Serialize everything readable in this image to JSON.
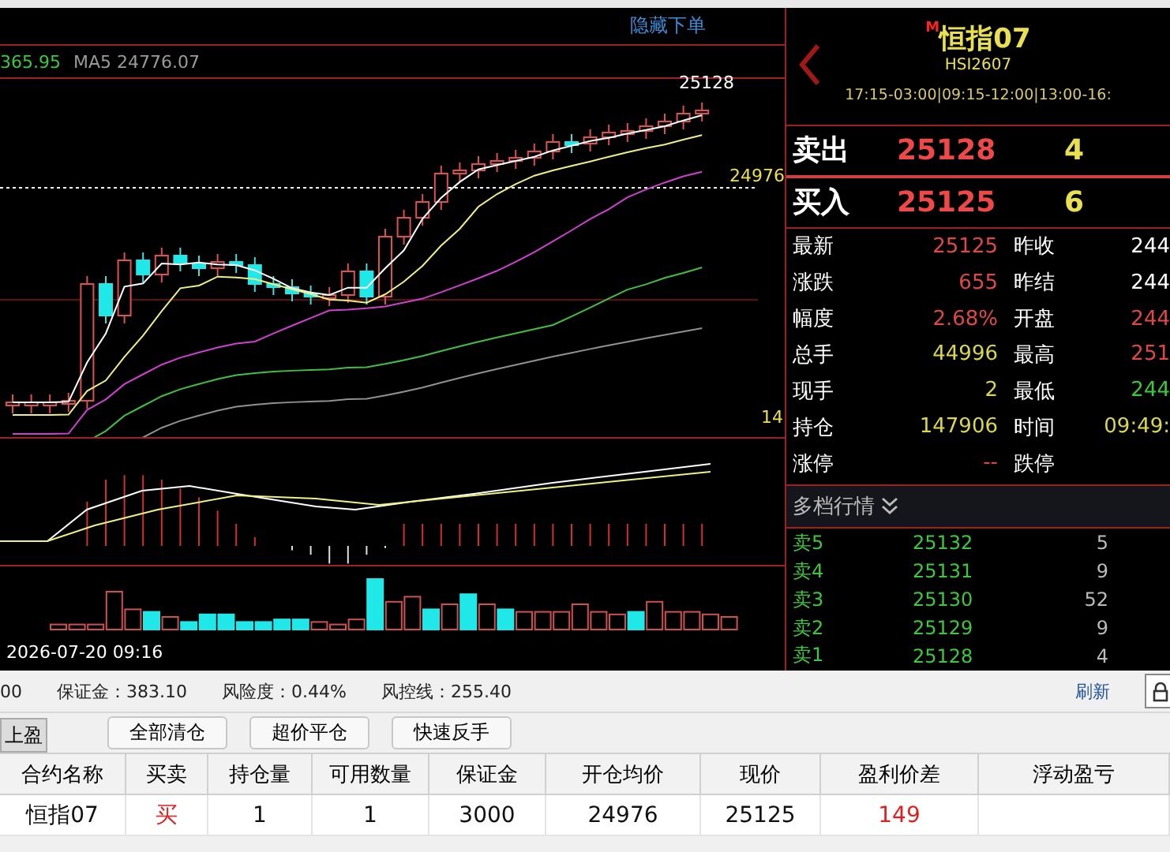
{
  "chart": {
    "hide_order_link": "隐藏下单",
    "ma_legend": [
      {
        "text": "365.95",
        "color": "#3cc83c"
      },
      {
        "text": "MA5 24776.07",
        "color": "#9a9a9a"
      }
    ],
    "last_price_label": "25128",
    "order_price_label": "24976",
    "axis_label": "14",
    "date_label": "2026-07-20 09:16"
  },
  "quote": {
    "market_badge": "M",
    "title": "恒指07",
    "code": "HSI2607",
    "sessions": "17:15-03:00|09:15-12:00|13:00-16:",
    "ask": {
      "label": "卖出",
      "price": "25128",
      "volume": "4"
    },
    "bid": {
      "label": "买入",
      "price": "25125",
      "volume": "6"
    },
    "stats": [
      {
        "left": {
          "label": "最新",
          "value": "25125",
          "color": "#e04848"
        },
        "right": {
          "label": "昨收",
          "value": "244",
          "color": "#ffffff"
        }
      },
      {
        "left": {
          "label": "涨跌",
          "value": "655",
          "color": "#e04848"
        },
        "right": {
          "label": "昨结",
          "value": "244",
          "color": "#ffffff"
        }
      },
      {
        "left": {
          "label": "幅度",
          "value": "2.68%",
          "color": "#e04848"
        },
        "right": {
          "label": "开盘",
          "value": "244",
          "color": "#e04848"
        }
      },
      {
        "left": {
          "label": "总手",
          "value": "44996",
          "color": "#d8d84a"
        },
        "right": {
          "label": "最高",
          "value": "251",
          "color": "#e04848"
        }
      },
      {
        "left": {
          "label": "现手",
          "value": "2",
          "color": "#d8d84a"
        },
        "right": {
          "label": "最低",
          "value": "244",
          "color": "#3cc83c"
        }
      },
      {
        "left": {
          "label": "持仓",
          "value": "147906",
          "color": "#d8d84a"
        },
        "right": {
          "label": "时间",
          "value": "09:49:",
          "color": "#d8d84a"
        }
      },
      {
        "left": {
          "label": "涨停",
          "value": "--",
          "color": "#e04848"
        },
        "right": {
          "label": "跌停"
        }
      }
    ],
    "depth_title": "多档行情",
    "depth": [
      {
        "label": "卖5",
        "price": "25132",
        "volume": "5"
      },
      {
        "label": "卖4",
        "price": "25131",
        "volume": "9"
      },
      {
        "label": "卖3",
        "price": "25130",
        "volume": "52"
      },
      {
        "label": "卖2",
        "price": "25129",
        "volume": "9"
      },
      {
        "label": "卖1",
        "price": "25128",
        "volume": "4"
      }
    ]
  },
  "account": {
    "items": [
      "00",
      "保证金：383.10",
      "风险度：0.44%",
      "风控线：255.40"
    ],
    "refresh": "刷新"
  },
  "tabs": [
    {
      "label": "上盈",
      "selected": true
    }
  ],
  "buttons": [
    "全部清仓",
    "超价平仓",
    "快速反手"
  ],
  "table": {
    "columns": [
      "合约名称",
      "买卖",
      "持仓量",
      "可用数量",
      "保证金",
      "开仓均价",
      "现价",
      "盈利价差",
      "浮动盈亏"
    ],
    "rows": [
      {
        "cells": [
          {
            "text": "恒指07"
          },
          {
            "text": "买",
            "color": "#e02020"
          },
          {
            "text": "1"
          },
          {
            "text": "1"
          },
          {
            "text": "3000"
          },
          {
            "text": "24976"
          },
          {
            "text": "25125"
          },
          {
            "text": "149",
            "color": "#e02020"
          },
          {}
        ]
      }
    ]
  }
}
